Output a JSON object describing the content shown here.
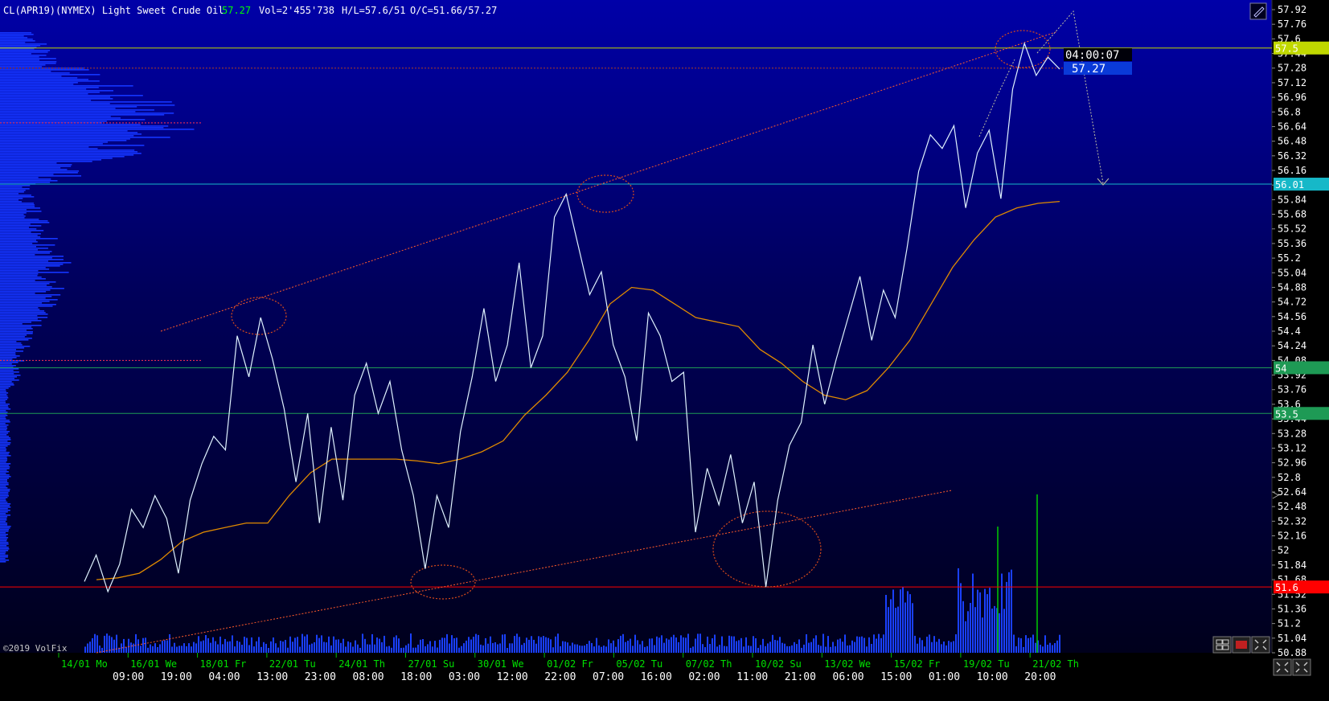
{
  "header": {
    "symbol": "CL(APR19)(NYMEX) Light Sweet Crude Oil",
    "last": "57.27",
    "volume": "Vol=2'455'738",
    "high_low": "H/L=57.6/51",
    "open_close": "O/C=51.66/57.27"
  },
  "price_tag": {
    "timer": "04:00:07",
    "price": "57.27"
  },
  "copyright": "©2019 VolFix",
  "colors": {
    "price_line": "#dff2ff",
    "moving_average": "#e08a00",
    "trendline": "#ff5a2a",
    "annotation": "#d94a1a",
    "axis_text": "#ffffff",
    "date_text": "#00e000"
  },
  "chart_data": {
    "type": "line",
    "title": "CL(APR19)(NYMEX) Light Sweet Crude Oil",
    "ylim": [
      50.88,
      57.92
    ],
    "grid": false,
    "y_ticks": [
      "57.92",
      "57.76",
      "57.6",
      "57.44",
      "57.28",
      "57.12",
      "56.96",
      "56.8",
      "56.64",
      "56.48",
      "56.32",
      "56.16",
      "56.0",
      "55.84",
      "55.68",
      "55.52",
      "55.36",
      "55.2",
      "55.04",
      "54.88",
      "54.72",
      "54.56",
      "54.4",
      "54.24",
      "54.08",
      "53.92",
      "53.76",
      "53.6",
      "53.44",
      "53.28",
      "53.12",
      "52.96",
      "52.8",
      "52.64",
      "52.48",
      "52.32",
      "52.16",
      "52",
      "51.84",
      "51.68",
      "51.52",
      "51.36",
      "51.2",
      "51.04",
      "50.88"
    ],
    "date_labels": [
      "14/01 Mo",
      "16/01 We",
      "18/01 Fr",
      "22/01 Tu",
      "24/01 Th",
      "27/01 Su",
      "30/01 We",
      "01/02 Fr",
      "05/02 Tu",
      "07/02 Th",
      "10/02 Su",
      "13/02 We",
      "15/02 Fr",
      "19/02 Tu",
      "21/02 Th"
    ],
    "time_labels": [
      "09:00",
      "19:00",
      "04:00",
      "13:00",
      "23:00",
      "08:00",
      "18:00",
      "03:00",
      "12:00",
      "22:00",
      "07:00",
      "16:00",
      "02:00",
      "11:00",
      "21:00",
      "06:00",
      "15:00",
      "01:00",
      "10:00",
      "20:00"
    ],
    "series": [
      {
        "values": [
          51.66,
          51.95,
          51.55,
          51.85,
          52.45,
          52.25,
          52.6,
          52.35,
          51.75,
          52.55,
          52.95,
          53.25,
          53.1,
          54.35,
          53.9,
          54.55,
          54.1,
          53.55,
          52.75,
          53.5,
          52.3,
          53.35,
          52.55,
          53.7,
          54.05,
          53.5,
          53.85,
          53.1,
          52.6,
          51.8,
          52.6,
          52.25,
          53.3,
          53.9,
          54.65,
          53.85,
          54.25,
          55.15,
          54.0,
          54.35,
          55.65,
          55.9,
          55.35,
          54.8,
          55.05,
          54.25,
          53.9,
          53.2,
          54.6,
          54.35,
          53.85,
          53.95,
          52.2,
          52.9,
          52.5,
          53.05,
          52.3,
          52.75,
          51.6,
          52.55,
          53.15,
          53.4,
          54.25,
          53.6,
          54.1,
          54.55,
          55.0,
          54.3,
          54.85,
          54.55,
          55.3,
          56.15,
          56.55,
          56.4,
          56.65,
          55.75,
          56.35,
          56.6,
          55.85,
          57.05,
          57.55,
          57.2,
          57.4,
          57.27
        ]
      },
      {
        "name": "",
        "values": [
          51.68,
          51.7,
          51.75,
          51.9,
          52.1,
          52.2,
          52.25,
          52.3,
          52.3,
          52.6,
          52.85,
          53.0,
          53.0,
          53.0,
          53.0,
          52.98,
          52.95,
          53.0,
          53.08,
          53.2,
          53.48,
          53.7,
          53.95,
          54.3,
          54.7,
          54.88,
          54.85,
          54.7,
          54.55,
          54.5,
          54.45,
          54.2,
          54.05,
          53.85,
          53.7,
          53.65,
          53.75,
          54.0,
          54.3,
          54.7,
          55.1,
          55.4,
          55.65,
          55.75,
          55.8,
          55.82
        ]
      }
    ],
    "horizontal_levels": [
      {
        "label": "57.5",
        "color": "#c0d800"
      },
      {
        "label": "56.01",
        "color": "#16b8c8"
      },
      {
        "label": "54",
        "color": "#1e9a55"
      },
      {
        "label": "53.5",
        "color": "#1e9a55"
      },
      {
        "label": "51.6",
        "color": "#ff0000"
      }
    ]
  }
}
